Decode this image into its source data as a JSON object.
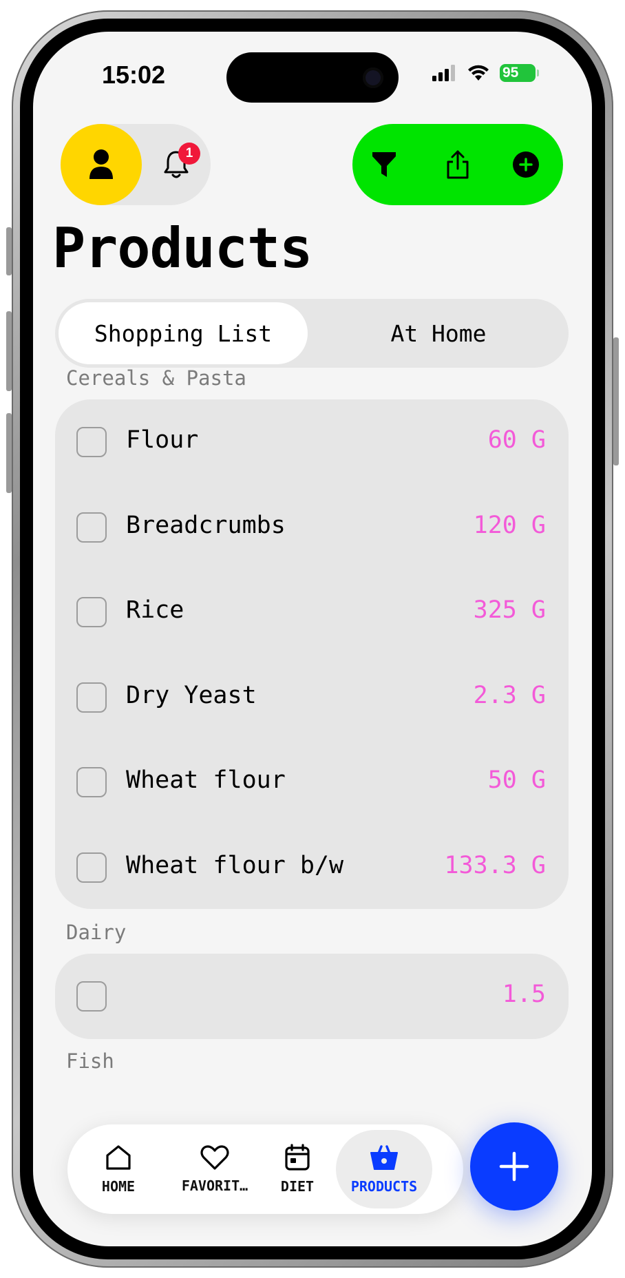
{
  "status_bar": {
    "time": "15:02",
    "battery": "95"
  },
  "header": {
    "notification_count": "1"
  },
  "page_title": "Products",
  "segments": {
    "active": "Shopping List",
    "inactive": "At Home"
  },
  "sections": [
    {
      "title": "Cereals & Pasta",
      "items": [
        {
          "name": "Flour",
          "qty": "60 G"
        },
        {
          "name": "Breadcrumbs",
          "qty": "120 G"
        },
        {
          "name": "Rice",
          "qty": "325 G"
        },
        {
          "name": "Dry Yeast",
          "qty": "2.3 G"
        },
        {
          "name": "Wheat flour",
          "qty": "50 G"
        },
        {
          "name": "Wheat flour b/w",
          "qty": "133.3 G"
        }
      ]
    },
    {
      "title": "Dairy",
      "items": [
        {
          "name": "",
          "qty": "1.5"
        }
      ]
    },
    {
      "title": "Fish",
      "items": []
    }
  ],
  "tabbar": {
    "tabs": [
      {
        "label": "HOME",
        "icon": "home-icon"
      },
      {
        "label": "FAVORIT…",
        "icon": "heart-icon"
      },
      {
        "label": "DIET",
        "icon": "calendar-icon"
      },
      {
        "label": "PRODUCTS",
        "icon": "basket-icon",
        "active": true
      }
    ]
  },
  "colors": {
    "accent_blue": "#0a3cff",
    "profile_yellow": "#ffd600",
    "actions_green": "#00e400",
    "quantity_pink": "#f35ad8",
    "badge_red": "#f0183a"
  }
}
